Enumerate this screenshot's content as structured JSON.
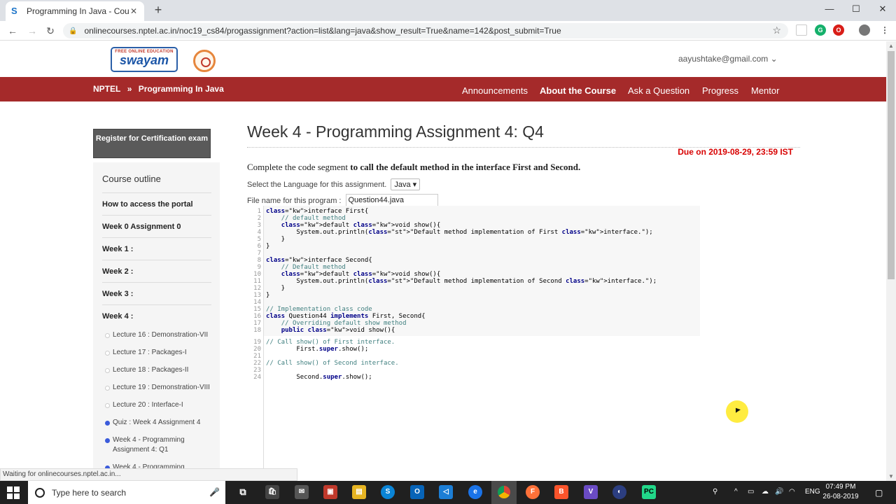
{
  "browser": {
    "tab_title": "Programming In Java - Course",
    "tab_favicon": "S",
    "url": "onlinecourses.nptel.ac.in/noc19_cs84/progassignment?action=list&lang=java&show_result=True&name=142&post_submit=True"
  },
  "site": {
    "logo_small": "FREE ONLINE EDUCATION",
    "logo_name": "swayam",
    "user_email": "aayushtake@gmail.com",
    "breadcrumb_root": "NPTEL",
    "breadcrumb_sep": "»",
    "breadcrumb_course": "Programming In Java",
    "nav": [
      "Announcements",
      "About the Course",
      "Ask a Question",
      "Progress",
      "Mentor"
    ]
  },
  "sidebar": {
    "register_label": "Register for Certification exam",
    "outline_title": "Course outline",
    "weeks": [
      "How to access the portal",
      "Week 0 Assignment 0",
      "Week 1 :",
      "Week 2 :",
      "Week 3 :",
      "Week 4 :"
    ],
    "lectures": [
      {
        "label": "Lecture 16 : Demonstration-VII",
        "done": false
      },
      {
        "label": "Lecture 17 : Packages-I",
        "done": false
      },
      {
        "label": "Lecture 18 : Packages-II",
        "done": false
      },
      {
        "label": "Lecture 19 : Demonstration-VIII",
        "done": false
      },
      {
        "label": "Lecture 20 : Interface-I",
        "done": false
      },
      {
        "label": "Quiz : Week 4 Assignment 4",
        "done": true
      },
      {
        "label": "Week 4 - Programming Assignment 4: Q1",
        "done": true
      },
      {
        "label": "Week 4 - Programming Assignment 4: Q2",
        "done": true
      },
      {
        "label": "Week 4 - Programming",
        "done": false
      }
    ]
  },
  "assignment": {
    "title": "Week 4 - Programming Assignment 4: Q4",
    "due": "Due on 2019-08-29, 23:59 IST",
    "desc_prefix": "Complete the code segment ",
    "desc_bold": "to call the default method in the interface First and Second.",
    "lang_label": "Select the Language for this assignment.",
    "lang_value": "Java ▾",
    "file_label": "File name for this program :",
    "file_value": "Question44.java"
  },
  "code_lines": [
    "interface First{",
    "    // default method",
    "    default void show(){",
    "        System.out.println(\"Default method implementation of First interface.\");",
    "    }",
    "}",
    "",
    "interface Second{",
    "    // Default method",
    "    default void show(){",
    "        System.out.println(\"Default method implementation of Second interface.\");",
    "    }",
    "}",
    "",
    "// Implementation class code",
    "class Question44 implements First, Second{",
    "    // Overriding default show method",
    "    public void show(){",
    "// Call show() of First interface.",
    "        First.super.show();",
    "",
    "// Call show() of Second interface.",
    "",
    "        Second.super.show();"
  ],
  "status_text": "Waiting for onlinecourses.nptel.ac.in...",
  "taskbar": {
    "search_placeholder": "Type here to search",
    "lang": "ENG",
    "time": "07:49 PM",
    "date": "26-08-2019"
  }
}
